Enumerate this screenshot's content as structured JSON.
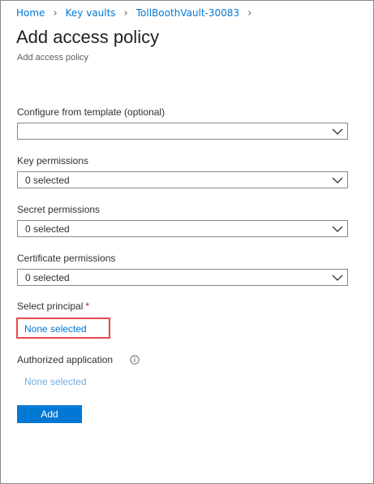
{
  "breadcrumb": {
    "items": [
      "Home",
      "Key vaults",
      "TollBoothVault-30083"
    ]
  },
  "header": {
    "title": "Add access policy",
    "subtitle": "Add access policy"
  },
  "form": {
    "template": {
      "label": "Configure from template (optional)",
      "value": ""
    },
    "key_permissions": {
      "label": "Key permissions",
      "value": "0 selected"
    },
    "secret_permissions": {
      "label": "Secret permissions",
      "value": "0 selected"
    },
    "certificate_permissions": {
      "label": "Certificate permissions",
      "value": "0 selected"
    },
    "select_principal": {
      "label": "Select principal",
      "required_marker": "*",
      "value": "None selected"
    },
    "authorized_application": {
      "label": "Authorized application",
      "value": "None selected"
    },
    "add_label": "Add"
  },
  "colors": {
    "accent": "#0078d4",
    "highlight_box": "#e8494a",
    "required": "#a4262c",
    "disabled_link": "#71afe5"
  },
  "icons": {
    "breadcrumb_separator": "chevron-right-icon",
    "dropdown": "chevron-down-icon",
    "info": "info-icon"
  }
}
